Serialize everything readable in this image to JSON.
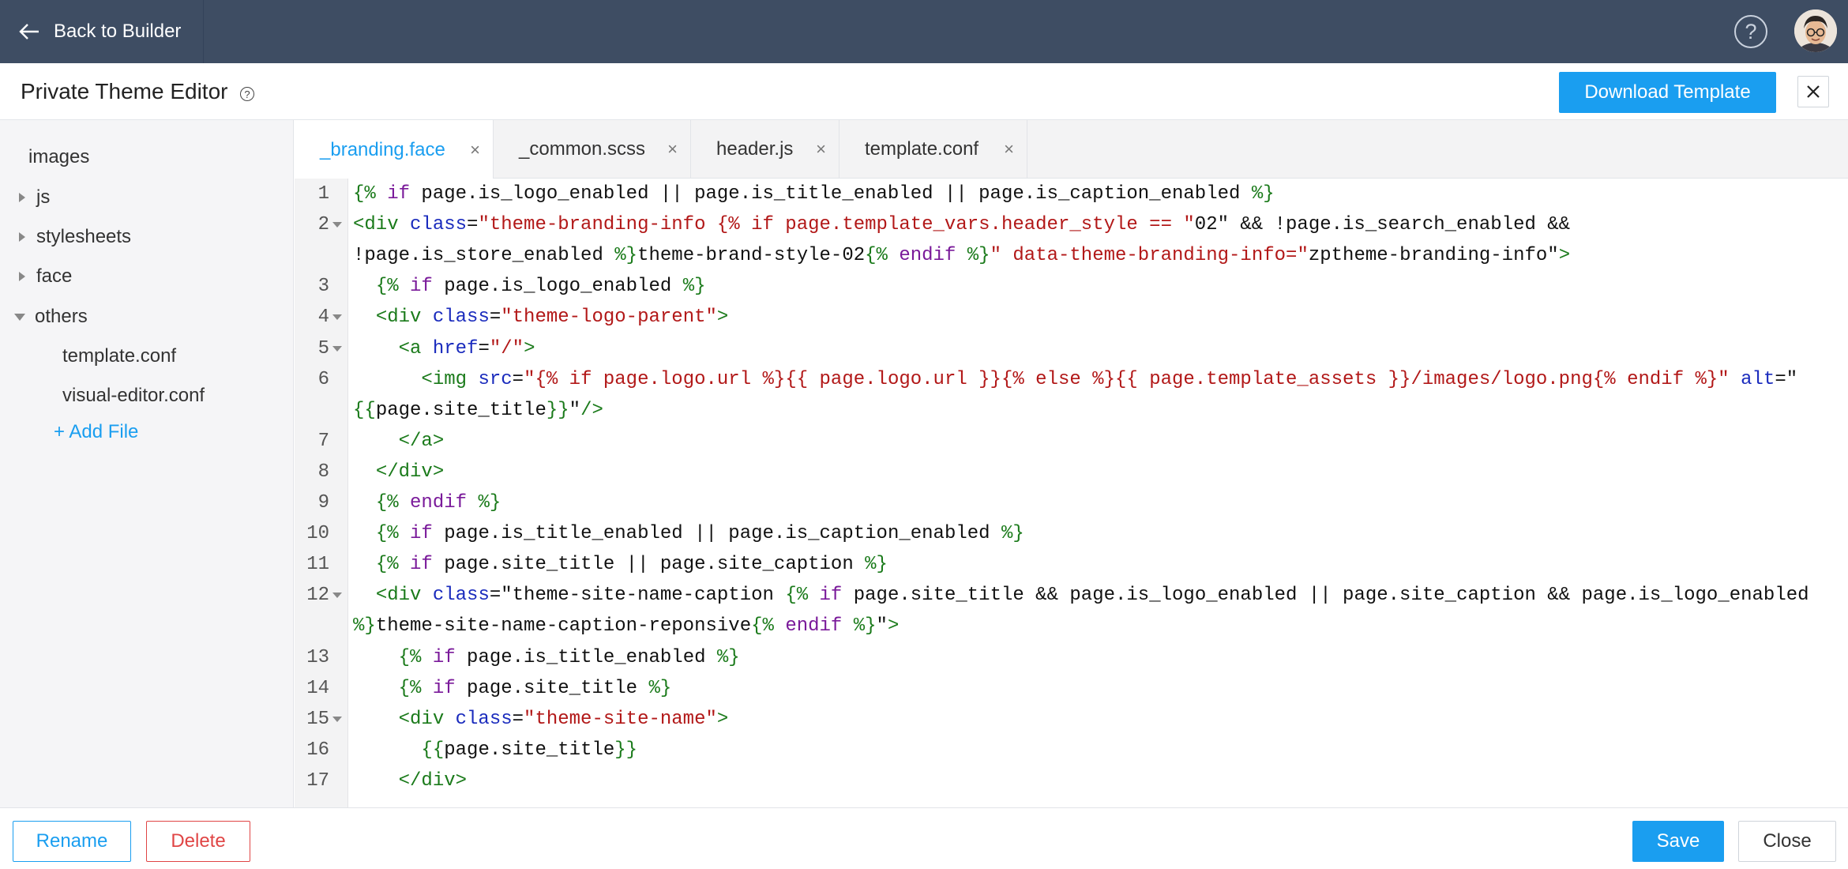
{
  "header": {
    "back_label": "Back to Builder",
    "help_icon": "help-circle-icon",
    "avatar_icon": "user-avatar"
  },
  "titlebar": {
    "title": "Private Theme Editor",
    "download_label": "Download Template"
  },
  "sidebar": {
    "items": [
      {
        "label": "images",
        "caret": "none"
      },
      {
        "label": "js",
        "caret": "right"
      },
      {
        "label": "stylesheets",
        "caret": "right"
      },
      {
        "label": "face",
        "caret": "right"
      },
      {
        "label": "others",
        "caret": "down"
      },
      {
        "label": "template.conf",
        "caret": "none"
      },
      {
        "label": "visual-editor.conf",
        "caret": "none"
      }
    ],
    "add_file_label": "+ Add File"
  },
  "tabs": [
    {
      "label": "_branding.face",
      "active": true
    },
    {
      "label": "_common.scss",
      "active": false
    },
    {
      "label": "header.js",
      "active": false
    },
    {
      "label": "template.conf",
      "active": false
    }
  ],
  "tab_close_glyph": "×",
  "editor": {
    "line_numbers": [
      "1",
      "2",
      "3",
      "4",
      "5",
      "6",
      "7",
      "8",
      "9",
      "10",
      "11",
      "12",
      "13",
      "14",
      "15",
      "16",
      "17"
    ],
    "code": [
      "{% if page.is_logo_enabled || page.is_title_enabled || page.is_caption_enabled %}",
      "<div class=\"theme-branding-info {% if page.template_vars.header_style == \"02\" && !page.is_search_enabled &&",
      "!page.is_store_enabled %}theme-brand-style-02{% endif %}\" data-theme-branding-info=\"zptheme-branding-info\">",
      "  {% if page.is_logo_enabled %}",
      "  <div class=\"theme-logo-parent\">",
      "    <a href=\"/\">",
      "      <img src=\"{% if page.logo.url %}{{ page.logo.url }}{% else %}{{ page.template_assets }}/images/logo.png{% endif %}\" alt=\"",
      "{{page.site_title}}\"/>",
      "    </a>",
      "  </div>",
      "  {% endif %}",
      "  {% if page.is_title_enabled || page.is_caption_enabled %}",
      "  {% if page.site_title || page.site_caption %}",
      "  <div class=\"theme-site-name-caption {% if page.site_title && page.is_logo_enabled || page.site_caption && page.is_logo_enabled",
      "%}theme-site-name-caption-reponsive{% endif %}\">",
      "    {% if page.is_title_enabled %}",
      "    {% if page.site_title %}",
      "    <div class=\"theme-site-name\">",
      "      {{page.site_title}}",
      "    </div>"
    ]
  },
  "footer": {
    "rename_label": "Rename",
    "delete_label": "Delete",
    "save_label": "Save",
    "close_label": "Close"
  },
  "colors": {
    "topbar": "#3e4d63",
    "accent": "#1a9ef0",
    "danger": "#e04545",
    "code_template": "#1a7a1a",
    "code_keyword": "#7a1a9a",
    "code_attribute": "#1a2bbd",
    "code_string": "#b21818"
  }
}
